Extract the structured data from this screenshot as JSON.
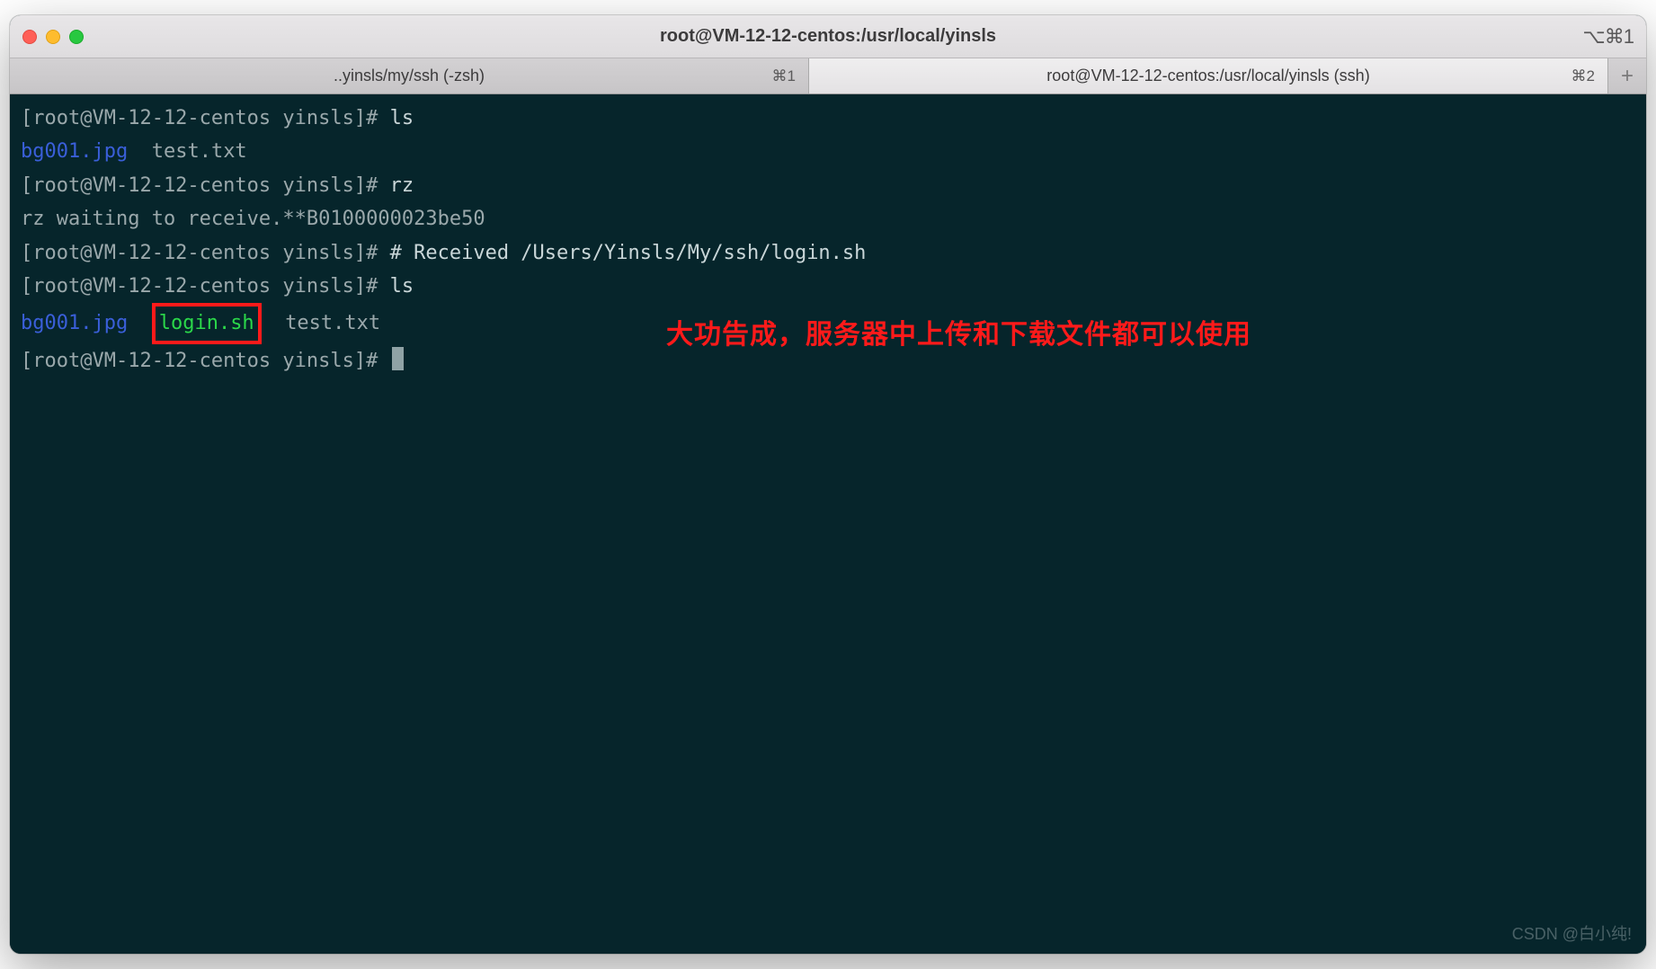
{
  "window": {
    "title": "root@VM-12-12-centos:/usr/local/yinsls",
    "right_shortcut": "⌥⌘1"
  },
  "tabs": [
    {
      "label": "..yinsls/my/ssh (-zsh)",
      "shortcut": "⌘1",
      "active": false
    },
    {
      "label": "root@VM-12-12-centos:/usr/local/yinsls (ssh)",
      "shortcut": "⌘2",
      "active": true
    }
  ],
  "terminal": {
    "prompt": "[root@VM-12-12-centos yinsls]# ",
    "lines": [
      {
        "type": "cmd",
        "command": "ls"
      },
      {
        "type": "ls_out",
        "files": [
          {
            "name": "bg001.jpg",
            "style": "blue"
          },
          {
            "name": "test.txt",
            "style": "plain"
          }
        ]
      },
      {
        "type": "cmd",
        "command": "rz"
      },
      {
        "type": "plain",
        "text": "rz waiting to receive.**B0100000023be50"
      },
      {
        "type": "cmd",
        "command": "# Received /Users/Yinsls/My/ssh/login.sh"
      },
      {
        "type": "cmd",
        "command": "ls"
      },
      {
        "type": "ls_out",
        "files": [
          {
            "name": "bg001.jpg",
            "style": "blue"
          },
          {
            "name": "login.sh",
            "style": "green",
            "boxed": true
          },
          {
            "name": "test.txt",
            "style": "plain"
          }
        ]
      },
      {
        "type": "cmd",
        "command": "",
        "cursor": true
      }
    ]
  },
  "annotation": "大功告成，服务器中上传和下载文件都可以使用",
  "watermark": "CSDN @白小纯!"
}
